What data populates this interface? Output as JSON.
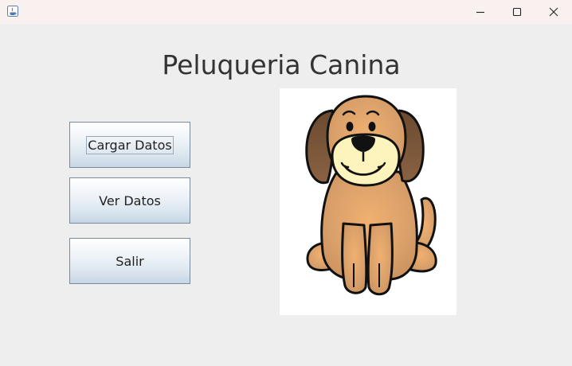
{
  "window": {
    "controls": {
      "minimize_icon": "minimize-icon",
      "maximize_icon": "maximize-icon",
      "close_icon": "close-icon"
    }
  },
  "main": {
    "title": "Peluqueria Canina",
    "buttons": {
      "cargar": "Cargar Datos",
      "ver": "Ver Datos",
      "salir": "Salir"
    },
    "image": "dog-illustration"
  },
  "colors": {
    "background": "#eeeeee",
    "titlebar": "#f8f1f0",
    "dog_fur": "#d9a06a",
    "dog_ears": "#7a5638",
    "dog_muzzle": "#fdf4bd"
  }
}
